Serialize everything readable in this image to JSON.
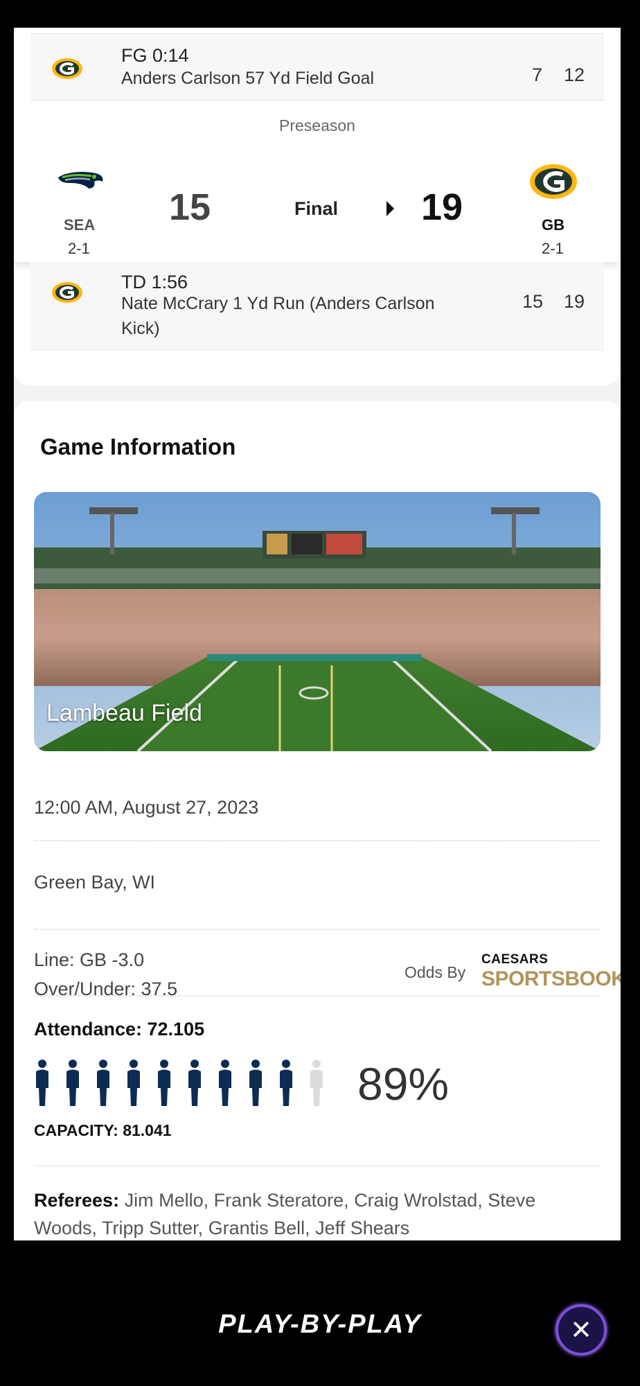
{
  "scoring_plays": [
    {
      "type": "FG 0:14",
      "description": "Anders Carlson 57 Yd Field Goal",
      "away_score": "7",
      "home_score": "12"
    }
  ],
  "section_label": "Preseason",
  "scoreboard": {
    "away": {
      "abbr": "SEA",
      "record": "2-1",
      "score": "15"
    },
    "home": {
      "abbr": "GB",
      "record": "2-1",
      "score": "19"
    },
    "status": "Final"
  },
  "last_play": {
    "type": "TD 1:56",
    "description_line1": "Nate McCrary 1 Yd Run (Anders Carlson",
    "description_line2": "Kick)",
    "away_score": "15",
    "home_score": "19"
  },
  "game_info": {
    "title": "Game Information",
    "venue": "Lambeau Field",
    "datetime": "12:00 AM, August 27, 2023",
    "location": "Green Bay, WI",
    "line": "Line: GB -3.0",
    "over_under": "Over/Under: 37.5",
    "odds_by": "Odds By",
    "sportsbook_top": "CAESARS",
    "sportsbook_bottom": "SPORTSBOOK",
    "attendance": "Attendance: 72.105",
    "attendance_fraction": 0.89,
    "attendance_pct": "89%",
    "capacity": "CAPACITY: 81.041",
    "referees_label": "Referees:",
    "referees": "Jim Mello, Frank Steratore, Craig Wrolstad, Steve Woods, Tripp Sutter, Grantis Bell, Jeff Shears"
  },
  "bottom_bar": {
    "title": "PLAY-BY-PLAY",
    "close": "✕"
  },
  "colors": {
    "packers_green": "#203731",
    "packers_gold": "#FFB612",
    "seahawks_navy": "#002244",
    "person_filled": "#0d2c54",
    "person_empty": "#dcdcdc",
    "sportsbook_gold": "#b0955a"
  }
}
